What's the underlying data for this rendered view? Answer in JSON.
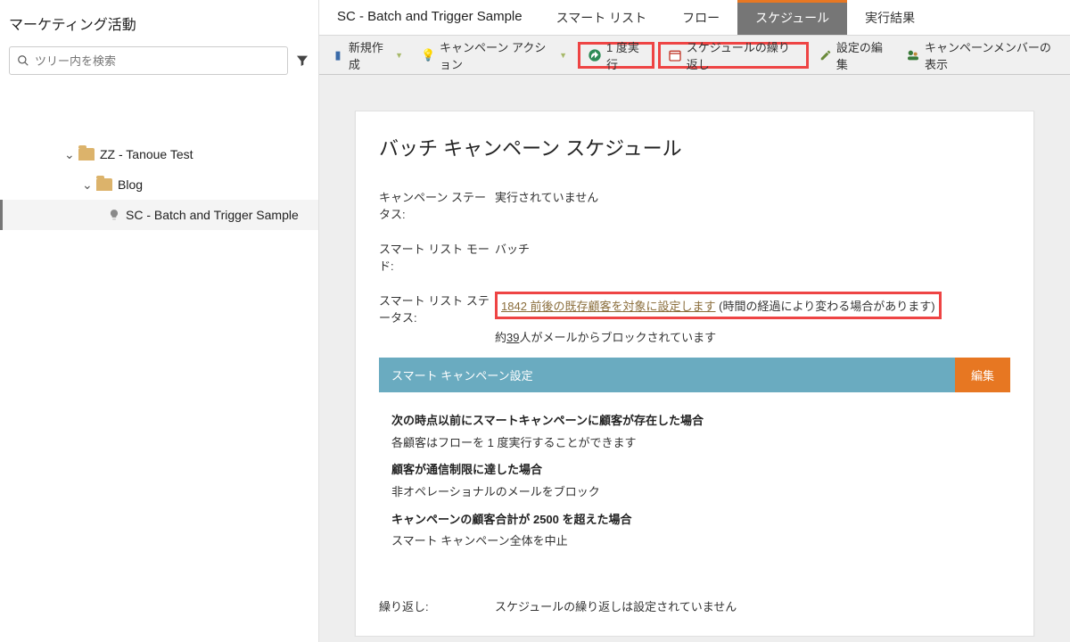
{
  "sidebar": {
    "title": "マーケティング活動",
    "searchPlaceholder": "ツリー内を検索",
    "tree": {
      "zz": "ZZ - Tanoue Test",
      "blog": "Blog",
      "item": "SC - Batch and Trigger Sample"
    }
  },
  "tabs": {
    "campaignName": "SC - Batch and Trigger Sample",
    "smartList": "スマート リスト",
    "flow": "フロー",
    "schedule": "スケジュール",
    "results": "実行結果"
  },
  "toolbar": {
    "new": "新規作成",
    "actions": "キャンペーン アクション",
    "runOnce": "1 度実行",
    "recurrence": "スケジュールの繰り返し",
    "editSettings": "設定の編集",
    "members": "キャンペーンメンバーの表示"
  },
  "schedule": {
    "heading": "バッチ キャンペーン スケジュール",
    "statusLabel": "キャンペーン ステータス:",
    "statusValue": "実行されていません",
    "modeLabel": "スマート リスト モード:",
    "modeValue": "バッチ",
    "slStatusLabel": "スマート リスト ステータス:",
    "slStatusCount": "1842",
    "slStatusLink": " 前後の既存顧客を対象に設定します",
    "slStatusNote": " (時間の経過により変わる場合があります)",
    "blockedPrefix": "約",
    "blockedCount": "39",
    "blockedSuffix": "人がメールからブロックされています",
    "settingsTitle": "スマート キャンペーン設定",
    "editBtn": "編集",
    "rule1h": "次の時点以前にスマートキャンペーンに顧客が存在した場合",
    "rule1t": "各顧客はフローを 1 度実行することができます",
    "rule2h": "顧客が通信制限に達した場合",
    "rule2t": "非オペレーショナルのメールをブロック",
    "rule3h": "キャンペーンの顧客合計が 2500 を超えた場合",
    "rule3t": "スマート キャンペーン全体を中止",
    "repeatLabel": "繰り返し:",
    "repeatValue": "スケジュールの繰り返しは設定されていません"
  }
}
